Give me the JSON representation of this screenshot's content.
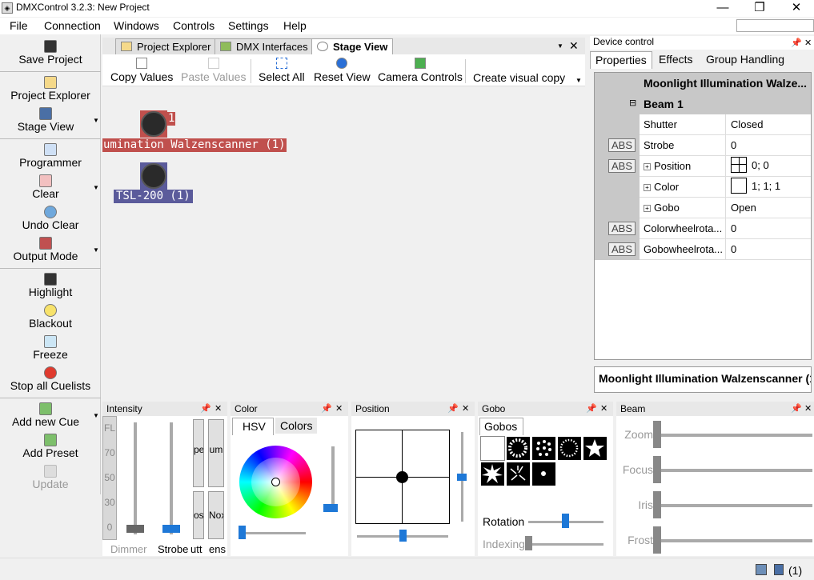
{
  "window": {
    "title": "DMXControl 3.2.3: New Project",
    "min": "—",
    "max": "❐",
    "close": "✕"
  },
  "menu": [
    "File",
    "Connection",
    "Windows",
    "Controls",
    "Settings",
    "Help"
  ],
  "left_toolbar": {
    "save": "Save Project",
    "explorer": "Project Explorer",
    "stage": "Stage View",
    "programmer": "Programmer",
    "clear": "Clear",
    "undo_clear": "Undo Clear",
    "output_mode": "Output Mode",
    "highlight": "Highlight",
    "blackout": "Blackout",
    "freeze": "Freeze",
    "stop_cuelists": "Stop all Cuelists",
    "add_cue": "Add new Cue",
    "add_preset": "Add Preset",
    "update": "Update"
  },
  "doc_tabs": [
    "Project Explorer",
    "DMX Interfaces",
    "Stage View"
  ],
  "stage_toolbar": [
    "Copy Values",
    "Paste Values",
    "Select All",
    "Reset View",
    "Camera Controls",
    "Create visual copy"
  ],
  "stage": {
    "fixture1_num": "1",
    "fixture1_label": "umination Walzenscanner (1)",
    "fixture2_label": "TSL-200 (1)",
    "fixture1_color": "#c0504d",
    "fixture2_color": "#5b5b9b"
  },
  "device_control": {
    "title": "Device control",
    "tabs": [
      "Properties",
      "Effects",
      "Group Handling"
    ],
    "header": "Moonlight Illumination Walze...",
    "group": "Beam 1",
    "rows": [
      {
        "abs": "",
        "name": "Shutter",
        "value": "Closed",
        "plus": ""
      },
      {
        "abs": "ABS",
        "name": "Strobe",
        "value": "0",
        "plus": ""
      },
      {
        "abs": "ABS",
        "name": "Position",
        "value": "0; 0",
        "plus": "+"
      },
      {
        "abs": "",
        "name": "Color",
        "value": "1; 1; 1",
        "plus": "+"
      },
      {
        "abs": "",
        "name": "Gobo",
        "value": "Open",
        "plus": "+"
      },
      {
        "abs": "ABS",
        "name": "Colorwheelrota...",
        "value": "0",
        "plus": ""
      },
      {
        "abs": "ABS",
        "name": "Gobowheelrota...",
        "value": "0",
        "plus": ""
      }
    ],
    "footer": "Moonlight Illumination Walzenscanner (1"
  },
  "docks": {
    "intensity": {
      "title": "Intensity",
      "scale": [
        "FL",
        "70",
        "50",
        "30",
        "0"
      ],
      "dimmer": "Dimmer",
      "strobe": "Strobe",
      "shutter": "utt",
      "lens": "ens",
      "box1": "pe",
      "box2": "um",
      "box3": "os",
      "box4": "Nox"
    },
    "color": {
      "title": "Color",
      "tabs": [
        "HSV",
        "Colors"
      ]
    },
    "position": {
      "title": "Position"
    },
    "gobo": {
      "title": "Gobo",
      "tab": "Gobos",
      "rotation": "Rotation",
      "indexing": "Indexing"
    },
    "beam": {
      "title": "Beam",
      "labels": [
        "Zoom",
        "Focus",
        "Iris",
        "Frost"
      ]
    }
  },
  "status": {
    "count": "(1)"
  }
}
